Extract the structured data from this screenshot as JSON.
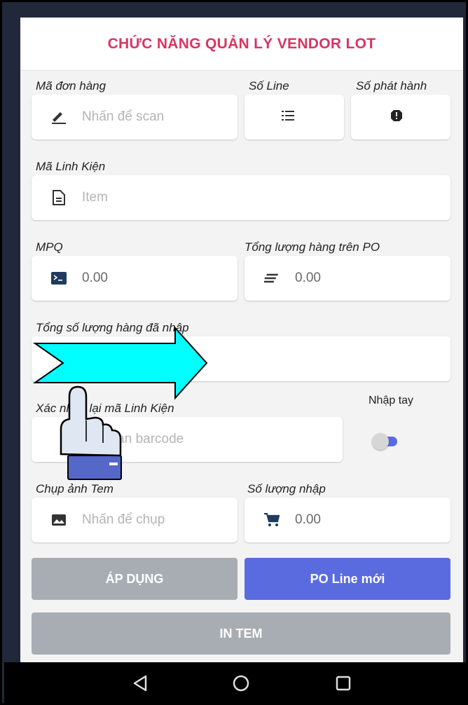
{
  "header": {
    "title": "CHỨC NĂNG QUẢN LÝ VENDOR LOT"
  },
  "order": {
    "label": "Mã đơn hàng",
    "placeholder": "Nhấn để scan",
    "icon": "pencil-icon"
  },
  "line": {
    "label": "Số Line",
    "icon": "list-icon"
  },
  "release": {
    "label": "Số phát hành",
    "icon": "alert-icon"
  },
  "part": {
    "label": "Mã Linh Kiện",
    "placeholder": "Item",
    "icon": "document-icon"
  },
  "mpq": {
    "label": "MPQ",
    "value": "0.00",
    "icon": "terminal-icon"
  },
  "po_total": {
    "label": "Tổng lượng hàng trên PO",
    "value": "0.00",
    "icon": "lines-icon"
  },
  "entered_total": {
    "label": "Tổng số lượng hàng đã nhập"
  },
  "confirm": {
    "label": "Xác nhận lại mã Linh Kiện",
    "placeholder": "Scan barcode"
  },
  "manual": {
    "label": "Nhập tay",
    "on": true
  },
  "photo": {
    "label": "Chụp ảnh Tem",
    "placeholder": "Nhấn để chụp",
    "icon": "image-icon"
  },
  "qty": {
    "label": "Số lượng nhập",
    "value": "0.00",
    "icon": "cart-icon"
  },
  "buttons": {
    "apply": "ÁP DỤNG",
    "new_line": "PO Line mới",
    "print": "IN TEM"
  },
  "colors": {
    "title": "#d83563",
    "accent": "#5a6be0",
    "disabled": "#a7adb3",
    "arrow": "#00ffff"
  }
}
